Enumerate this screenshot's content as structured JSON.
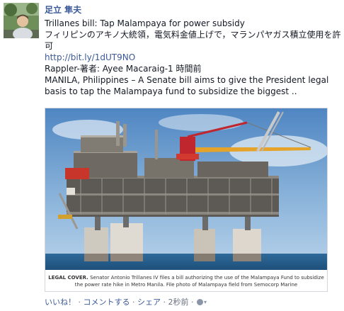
{
  "post": {
    "author": "足立 隼夫",
    "title_line": "Trillanes bill: Tap Malampaya for power subsidy",
    "summary_ja": "フィリピンのアキノ大統領，電気料金値上げで，マランパヤガス積立使用を許可",
    "link": "http://bit.ly/1dUT9NO",
    "source": "Rappler-著者: Ayee Macaraig-1 時間前",
    "excerpt": "MANILA, Philippines – A Senate bill aims to give the President legal basis to tap the Malampaya fund to subsidize the biggest .."
  },
  "attachment": {
    "caption_bold": "LEGAL COVER.",
    "caption_text": "Senator Antonio Trillanes IV files a bill authorizing the use of the Malampaya Fund to subsidize the power rate hike in Metro Manila. File photo of Malampaya field from Semocorp Marine"
  },
  "actions": {
    "like": "いいね！",
    "comment": "コメントする",
    "share": "シェア",
    "time": "2秒前",
    "separator": "·",
    "caret": "▾"
  }
}
